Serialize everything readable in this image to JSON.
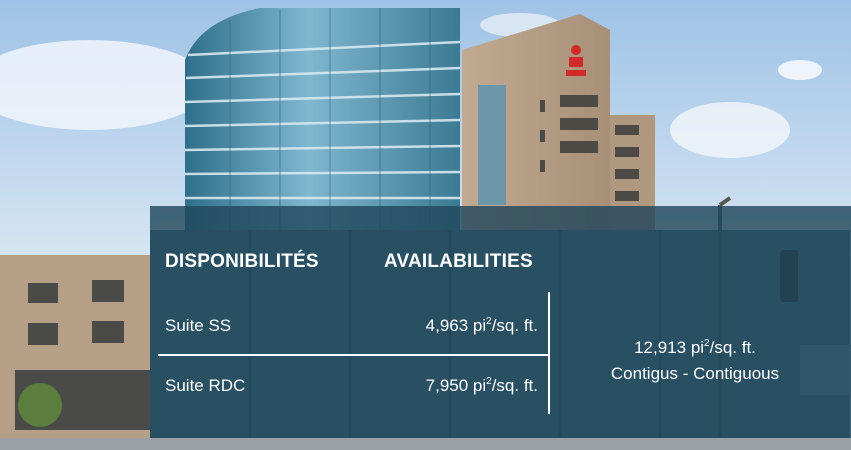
{
  "headings": {
    "french": "DISPONIBILITÉS",
    "english": "AVAILABILITIES"
  },
  "suites": [
    {
      "name": "Suite SS",
      "area_value": "4,963 pi",
      "area_sup": "2",
      "area_unit": "/sq. ft."
    },
    {
      "name": "Suite RDC",
      "area_value": "7,950 pi",
      "area_sup": "2",
      "area_unit": "/sq. ft."
    }
  ],
  "total": {
    "area_value": "12,913 pi",
    "area_sup": "2",
    "area_unit": "/sq. ft.",
    "note": "Contigus - Contiguous"
  },
  "colors": {
    "overlay": "#21485c",
    "sky": "#bcd5ee",
    "glass": "#4f8fae",
    "brick": "#b59f86",
    "logo_red": "#d12a2a"
  }
}
